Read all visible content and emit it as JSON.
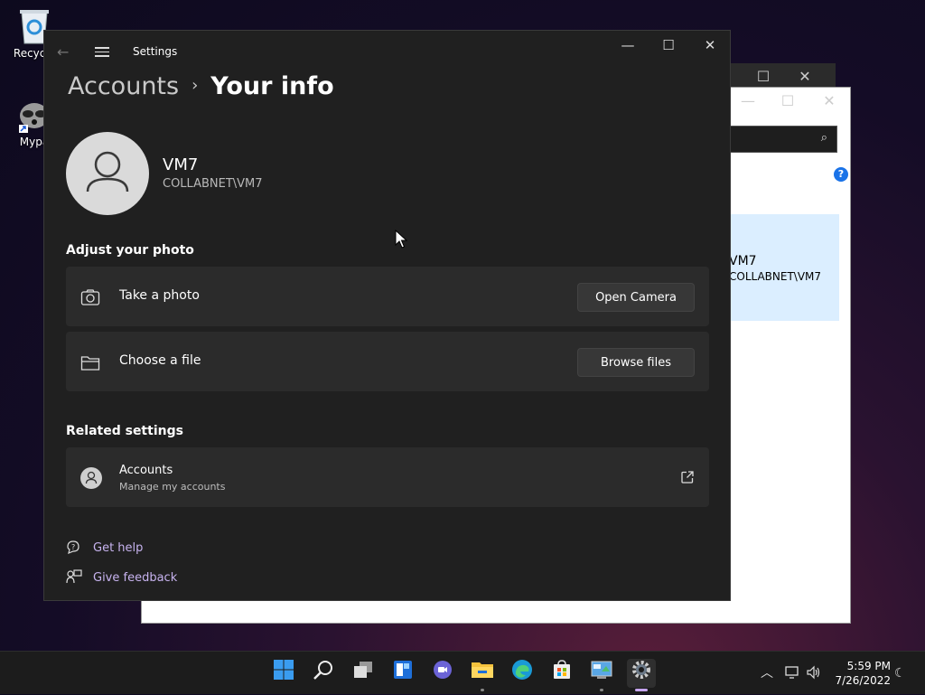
{
  "desktop": {
    "icons": [
      {
        "label": "Recycle",
        "icon": "recycle-bin-icon"
      },
      {
        "label": "Mypa",
        "icon": "raccoon-app-icon"
      }
    ]
  },
  "background_window": {
    "user_name": "VM7",
    "user_domain": "COLLABNET\\VM7",
    "help_icon": "?"
  },
  "settings": {
    "window_title": "Settings",
    "breadcrumb": {
      "parent": "Accounts",
      "separator": "›",
      "current": "Your info"
    },
    "user": {
      "name": "VM7",
      "domain": "COLLABNET\\VM7"
    },
    "adjust_photo": {
      "heading": "Adjust your photo",
      "items": [
        {
          "label": "Take a photo",
          "icon": "camera-icon",
          "button": "Open Camera"
        },
        {
          "label": "Choose a file",
          "icon": "folder-icon",
          "button": "Browse files"
        }
      ]
    },
    "related": {
      "heading": "Related settings",
      "item": {
        "title": "Accounts",
        "subtitle": "Manage my accounts",
        "icon": "person-icon",
        "action_icon": "external-link-icon"
      }
    },
    "links": [
      {
        "label": "Get help",
        "icon": "help-icon"
      },
      {
        "label": "Give feedback",
        "icon": "feedback-icon"
      }
    ]
  },
  "taskbar": {
    "apps": [
      "start",
      "search",
      "task-view",
      "widgets",
      "chat",
      "file-explorer",
      "edge",
      "store",
      "control-panel",
      "settings"
    ],
    "clock": {
      "time": "5:59 PM",
      "date": "7/26/2022"
    }
  },
  "colors": {
    "accent": "#c7b3ef",
    "window_bg": "#202020",
    "card_bg": "#2b2b2b"
  }
}
